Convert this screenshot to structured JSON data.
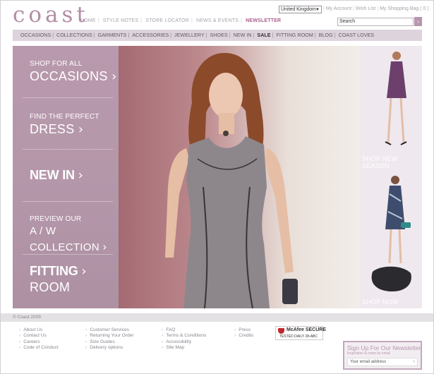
{
  "header": {
    "logo": "coast",
    "top_nav": [
      "HOME",
      "STYLE NOTES",
      "STORE LOCATOR",
      "NEWS & EVENTS",
      "NEWSLETTER"
    ],
    "country_select": "United Kingdom",
    "account_links": [
      "My Account",
      "Wish List",
      "My Shopping Bag ( 0 )"
    ],
    "search_placeholder": "Search"
  },
  "category_nav": [
    "OCCASIONS",
    "COLLECTIONS",
    "GARMENTS",
    "ACCESSORIES",
    "JEWELLERY",
    "SHOES",
    "NEW IN",
    "SALE",
    "FITTING ROOM",
    "BLOG",
    "COAST LOVES"
  ],
  "hero": {
    "menu": [
      {
        "small": "SHOP FOR ALL",
        "big": "OCCASIONS"
      },
      {
        "small": "FIND THE PERFECT",
        "big": "DRESS"
      },
      {
        "small": "",
        "big": "NEW IN"
      },
      {
        "small": "PREVIEW OUR",
        "big": "A / W COLLECTION"
      },
      {
        "small": "FITTING",
        "big": "ROOM"
      }
    ],
    "side_labels": [
      "SHOP NEW",
      "SEASON",
      "SHOP NOW"
    ]
  },
  "footer": {
    "copyright": "© Coast 2009",
    "col1": [
      "About Us",
      "Contact Us",
      "Careers",
      "Code of Conduct"
    ],
    "col2": [
      "Customer Services",
      "Returning Your Order",
      "Size Guides",
      "Delivery options"
    ],
    "col3": [
      "FAQ",
      "Terms & Conditions",
      "Accessibility",
      "Site Map"
    ],
    "col4": [
      "Press",
      "Credits"
    ],
    "mcafee_title": "McAfee SECURE",
    "mcafee_sub": "TESTED DAILY   28-ABC",
    "newsletter_title": "Sign Up For Our Newsletter",
    "newsletter_sub": "Inspiration & news by email",
    "newsletter_placeholder": "Your email address"
  },
  "colors": {
    "brand": "#b48ea6",
    "panel": "#b899ad",
    "accent": "#a9608d"
  }
}
